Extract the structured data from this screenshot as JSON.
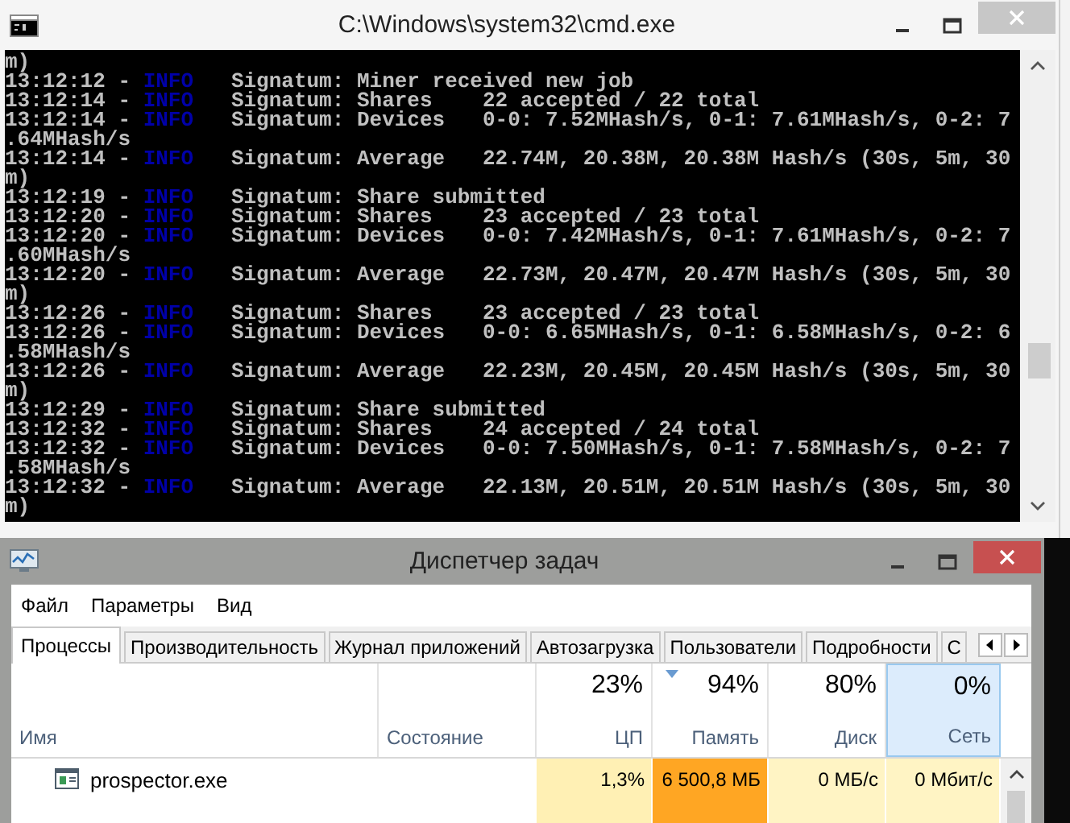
{
  "console_window": {
    "title": "C:\\Windows\\system32\\cmd.exe",
    "lines": [
      {
        "kind": "wrap",
        "text": "m)"
      },
      {
        "kind": "log",
        "prefix": "13:12:12 - ",
        "level": "INFO",
        "message": "   Signatum: Miner received new job"
      },
      {
        "kind": "log",
        "prefix": "13:12:14 - ",
        "level": "INFO",
        "message": "   Signatum: Shares    22 accepted / 22 total"
      },
      {
        "kind": "log",
        "prefix": "13:12:14 - ",
        "level": "INFO",
        "message": "   Signatum: Devices   0-0: 7.52MHash/s, 0-1: 7.61MHash/s, 0-2: 7"
      },
      {
        "kind": "wrap",
        "text": ".64MHash/s"
      },
      {
        "kind": "log",
        "prefix": "13:12:14 - ",
        "level": "INFO",
        "message": "   Signatum: Average   22.74M, 20.38M, 20.38M Hash/s (30s, 5m, 30"
      },
      {
        "kind": "wrap",
        "text": "m)"
      },
      {
        "kind": "log",
        "prefix": "13:12:19 - ",
        "level": "INFO",
        "message": "   Signatum: Share submitted"
      },
      {
        "kind": "log",
        "prefix": "13:12:20 - ",
        "level": "INFO",
        "message": "   Signatum: Shares    23 accepted / 23 total"
      },
      {
        "kind": "log",
        "prefix": "13:12:20 - ",
        "level": "INFO",
        "message": "   Signatum: Devices   0-0: 7.42MHash/s, 0-1: 7.61MHash/s, 0-2: 7"
      },
      {
        "kind": "wrap",
        "text": ".60MHash/s"
      },
      {
        "kind": "log",
        "prefix": "13:12:20 - ",
        "level": "INFO",
        "message": "   Signatum: Average   22.73M, 20.47M, 20.47M Hash/s (30s, 5m, 30"
      },
      {
        "kind": "wrap",
        "text": "m)"
      },
      {
        "kind": "log",
        "prefix": "13:12:26 - ",
        "level": "INFO",
        "message": "   Signatum: Shares    23 accepted / 23 total"
      },
      {
        "kind": "log",
        "prefix": "13:12:26 - ",
        "level": "INFO",
        "message": "   Signatum: Devices   0-0: 6.65MHash/s, 0-1: 6.58MHash/s, 0-2: 6"
      },
      {
        "kind": "wrap",
        "text": ".58MHash/s"
      },
      {
        "kind": "log",
        "prefix": "13:12:26 - ",
        "level": "INFO",
        "message": "   Signatum: Average   22.23M, 20.45M, 20.45M Hash/s (30s, 5m, 30"
      },
      {
        "kind": "wrap",
        "text": "m)"
      },
      {
        "kind": "log",
        "prefix": "13:12:29 - ",
        "level": "INFO",
        "message": "   Signatum: Share submitted"
      },
      {
        "kind": "log",
        "prefix": "13:12:32 - ",
        "level": "INFO",
        "message": "   Signatum: Shares    24 accepted / 24 total"
      },
      {
        "kind": "log",
        "prefix": "13:12:32 - ",
        "level": "INFO",
        "message": "   Signatum: Devices   0-0: 7.50MHash/s, 0-1: 7.58MHash/s, 0-2: 7"
      },
      {
        "kind": "wrap",
        "text": ".58MHash/s"
      },
      {
        "kind": "log",
        "prefix": "13:12:32 - ",
        "level": "INFO",
        "message": "   Signatum: Average   22.13M, 20.51M, 20.51M Hash/s (30s, 5m, 30"
      },
      {
        "kind": "wrap",
        "text": "m)"
      }
    ]
  },
  "task_manager": {
    "title": "Диспетчер задач",
    "menu": [
      "Файл",
      "Параметры",
      "Вид"
    ],
    "tabs": [
      {
        "label": "Процессы",
        "selected": true
      },
      {
        "label": "Производительность",
        "selected": false
      },
      {
        "label": "Журнал приложений",
        "selected": false
      },
      {
        "label": "Автозагрузка",
        "selected": false
      },
      {
        "label": "Пользователи",
        "selected": false
      },
      {
        "label": "Подробности",
        "selected": false
      },
      {
        "label": "С",
        "selected": false
      }
    ],
    "columns": [
      {
        "label": "Имя",
        "kind": "text",
        "sorted": false,
        "highlighted": false
      },
      {
        "label": "Состояние",
        "kind": "text",
        "sorted": false,
        "highlighted": false
      },
      {
        "label": "ЦП",
        "kind": "metric",
        "percent": "23%",
        "sorted": false,
        "highlighted": false
      },
      {
        "label": "Память",
        "kind": "metric",
        "percent": "94%",
        "sorted": true,
        "highlighted": false
      },
      {
        "label": "Диск",
        "kind": "metric",
        "percent": "80%",
        "sorted": false,
        "highlighted": false
      },
      {
        "label": "Сеть",
        "kind": "metric",
        "percent": "0%",
        "sorted": false,
        "highlighted": true
      }
    ],
    "rows": [
      {
        "cells": [
          {
            "text": "prospector.exe",
            "kind": "process"
          },
          {
            "text": "",
            "kind": "status"
          },
          {
            "text": "1,3%",
            "kind": "metric",
            "color": "#fff0b4"
          },
          {
            "text": "6 500,8 МБ",
            "kind": "metric",
            "color": "#ffa623"
          },
          {
            "text": "0 МБ/с",
            "kind": "metric",
            "color": "#fff4c4"
          },
          {
            "text": "0 Мбит/с",
            "kind": "metric",
            "color": "#fff4c4"
          }
        ]
      }
    ]
  }
}
